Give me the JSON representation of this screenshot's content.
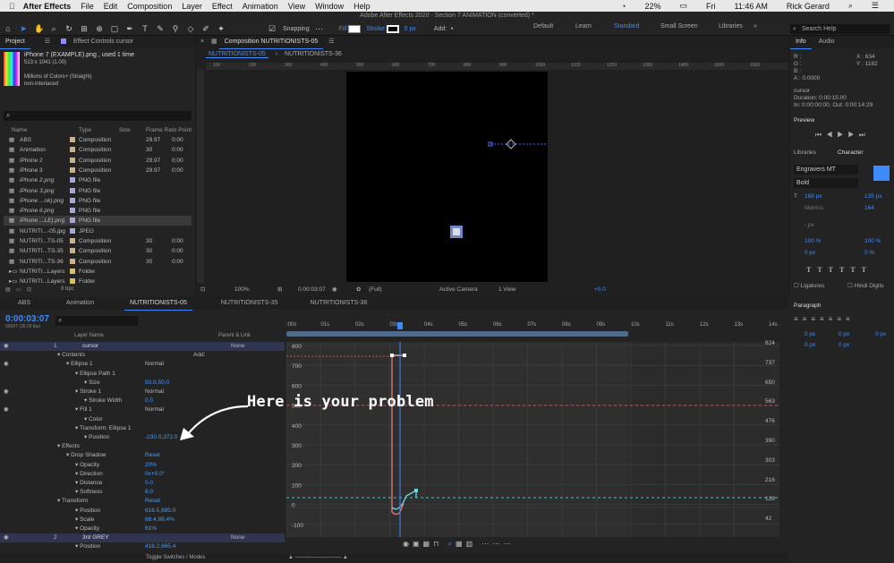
{
  "menubar": {
    "app": "After Effects",
    "items": [
      "File",
      "Edit",
      "Composition",
      "Layer",
      "Effect",
      "Animation",
      "View",
      "Window",
      "Help"
    ],
    "battery": "22%",
    "day": "Fri",
    "time": "11:46 AM",
    "user": "Rick Gerard"
  },
  "toolbar": {
    "window_title": "Adobe After Effects 2020 - Section 7 ANIMATION (converted) *",
    "snapping_label": "Snapping",
    "fill_label": "Fill:",
    "stroke_label": "Stroke:",
    "stroke_width": "0 px",
    "add_label": "Add:",
    "workspaces": [
      "Default",
      "Learn",
      "Standard",
      "Small Screen",
      "Libraries"
    ],
    "active_workspace": "Standard",
    "search_placeholder": "Search Help"
  },
  "project": {
    "tab_project": "Project",
    "tab_effect_controls": "Effect Controls cursor",
    "item_name": "iPhone 7 (EXAMPLE).png",
    "used": ", used 1 time",
    "dims": "513 x 1041 (1.00)",
    "colors": "Millions of Colors+ (Straight)",
    "interlace": "non-interlaced",
    "columns": [
      "Name",
      "Type",
      "Size",
      "Frame Ra...",
      "In Point"
    ],
    "rows": [
      {
        "name": "ABS",
        "type": "Composition",
        "fr": "29.97",
        "in": "0;00"
      },
      {
        "name": "Animation",
        "type": "Composition",
        "fr": "30",
        "in": "0:00"
      },
      {
        "name": "iPhone 2",
        "type": "Composition",
        "fr": "29.97",
        "in": "0;00"
      },
      {
        "name": "iPhone 3",
        "type": "Composition",
        "fr": "29.97",
        "in": "0;00"
      },
      {
        "name": "iPhone 2.png",
        "type": "PNG file",
        "fr": "",
        "in": ""
      },
      {
        "name": "iPhone 3.png",
        "type": "PNG file",
        "fr": "",
        "in": ""
      },
      {
        "name": "iPhone ...nk).png",
        "type": "PNG file",
        "fr": "",
        "in": ""
      },
      {
        "name": "iPhone 6.png",
        "type": "PNG file",
        "fr": "",
        "in": ""
      },
      {
        "name": "iPhone ...LE).png",
        "type": "PNG file",
        "fr": "",
        "in": ""
      },
      {
        "name": "NUTRITI...-05.jpg",
        "type": "JPEG",
        "fr": "",
        "in": ""
      },
      {
        "name": "NUTRITI...TS-05",
        "type": "Composition",
        "fr": "30",
        "in": "0:00"
      },
      {
        "name": "NUTRITI...TS-35",
        "type": "Composition",
        "fr": "30",
        "in": "0:00"
      },
      {
        "name": "NUTRITI...TS-36",
        "type": "Composition",
        "fr": "30",
        "in": "0:00"
      },
      {
        "name": "NUTRITI...Layers",
        "type": "Folder",
        "fr": "",
        "in": ""
      },
      {
        "name": "NUTRITI...Layers",
        "type": "Folder",
        "fr": "",
        "in": ""
      }
    ],
    "bpc": "8 bpc"
  },
  "comp": {
    "tab_label": "Composition NUTRITIONISTS-05",
    "subtabs": [
      "NUTRITIONISTS-05",
      "NUTRITIONISTS-36"
    ],
    "ruler_ticks": [
      "100",
      "200",
      "300",
      "400",
      "500",
      "600",
      "700",
      "800",
      "900",
      "1000",
      "1100",
      "1200",
      "1300",
      "1400",
      "1500",
      "1600"
    ],
    "zoom": "100%",
    "timecode": "0:00:03:07",
    "resolution": "(Full)",
    "camera": "Active Camera",
    "views": "1 View",
    "exposure": "+0.0"
  },
  "info": {
    "tab_info": "Info",
    "tab_audio": "Audio",
    "r": "R :",
    "g": "G :",
    "b": "B :",
    "a": "A : 0.0000",
    "x": "X : 634",
    "y": "Y : 1182",
    "layer": "cursor",
    "duration": "Duration: 0:00:15:00",
    "inout": "In: 0:00:00:00, Out: 0:00:14:29",
    "preview_tab": "Preview",
    "libraries_tab": "Libraries",
    "character_tab": "Character",
    "font": "Engravers MT",
    "style": "Bold",
    "size": "168 px",
    "leading": "135 px",
    "kerning": "Metrics",
    "tracking": "164",
    "stroke_px": "- px",
    "vscale": "100 %",
    "hscale": "100 %",
    "baseline": "0 px",
    "tsume": "0 %",
    "ligatures": "Ligatures",
    "hindi": "Hindi Digits",
    "paragraph_tab": "Paragraph",
    "para_vals": [
      "0 px",
      "0 px",
      "0 px",
      "0 px",
      "0 px"
    ]
  },
  "timeline": {
    "tabs": [
      "ABS",
      "Animation",
      "NUTRITIONISTS-05",
      "NUTRITIONISTS-35",
      "NUTRITIONISTS-36"
    ],
    "active_tab": "NUTRITIONISTS-05",
    "timecode": "0:00:03:07",
    "frames": "00097 (30.00 fps)",
    "col_layer_name": "Layer Name",
    "col_parent": "Parent & Link",
    "time_ticks": [
      ":00s",
      "01s",
      "02s",
      "03s",
      "04s",
      "05s",
      "06s",
      "07s",
      "08s",
      "09s",
      "10s",
      "11s",
      "12s",
      "13s",
      "14s"
    ],
    "graph_labels": [
      "824",
      "737",
      "650",
      "563",
      "476",
      "390",
      "303",
      "216",
      "129",
      "42"
    ],
    "graph_left_labels": [
      "800",
      "700",
      "600",
      "500",
      "400",
      "300",
      "200",
      "100",
      "0",
      "-100"
    ],
    "toggle_label": "Toggle Switches / Modes",
    "layers": [
      {
        "text": "1",
        "name": "cursor",
        "parent": "None"
      },
      {
        "text": "Contents",
        "add": "Add:"
      },
      {
        "text": "Ellipse 1",
        "value": "Normal"
      },
      {
        "text": "Ellipse Path 1"
      },
      {
        "text": "Size",
        "value": "50.0,50.0"
      },
      {
        "text": "Stroke 1",
        "value": "Normal"
      },
      {
        "text": "Stroke Width",
        "value": "0.0"
      },
      {
        "text": "Fill 1",
        "value": "Normal"
      },
      {
        "text": "Color"
      },
      {
        "text": "Transform: Ellipse 1"
      },
      {
        "text": "Position",
        "value": "-230.0,372.0"
      },
      {
        "text": "Effects"
      },
      {
        "text": "Drop Shadow",
        "value": "Reset"
      },
      {
        "text": "Opacity",
        "value": "20%"
      },
      {
        "text": "Direction",
        "value": "0x+0.0°"
      },
      {
        "text": "Distance",
        "value": "0.0"
      },
      {
        "text": "Softness",
        "value": "8.0"
      },
      {
        "text": "Transform",
        "value": "Reset"
      },
      {
        "text": "Position",
        "value": "616.5,685.0"
      },
      {
        "text": "Scale",
        "value": "88.4,88.4%"
      },
      {
        "text": "Opacity",
        "value": "61%"
      },
      {
        "text": "2",
        "name": "3rd GREY",
        "parent": "None"
      },
      {
        "text": "Position",
        "value": "416.2,665.4"
      }
    ]
  },
  "annotation": "Here is your problem",
  "colors": {
    "accent": "#3d8bff",
    "panel": "#232323",
    "red_curve": "#e57a7a",
    "cyan_curve": "#6fd5e0"
  }
}
